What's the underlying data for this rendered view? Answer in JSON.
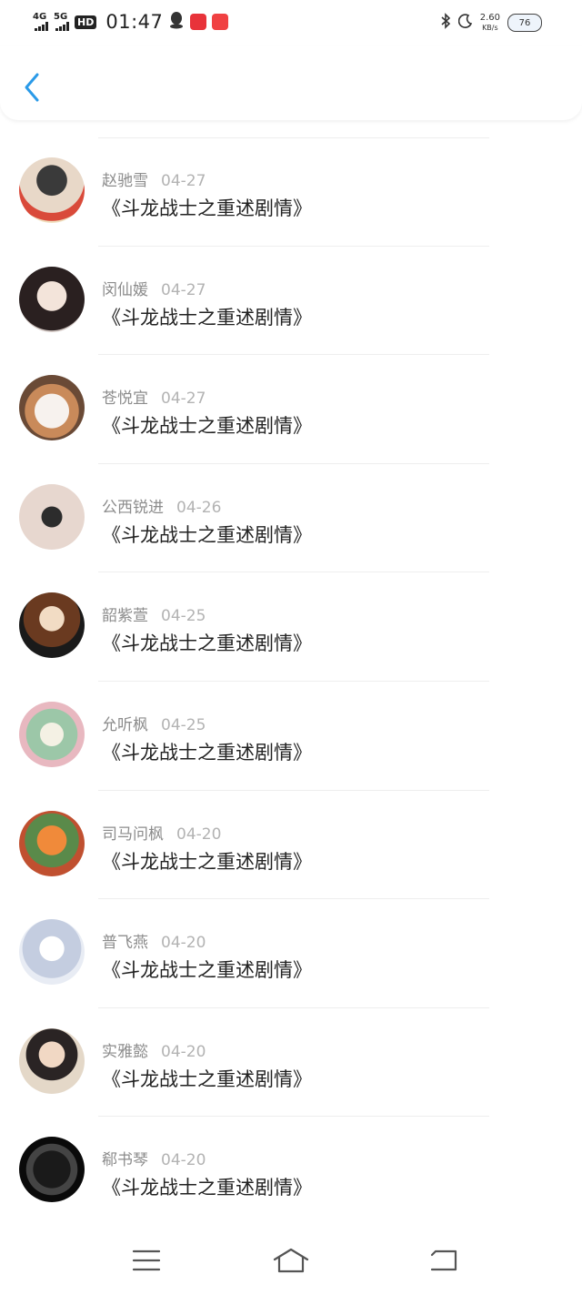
{
  "status_bar": {
    "net1": "4G",
    "net2": "5G",
    "hd": "HD",
    "time": "01:47",
    "speed_value": "2.60",
    "speed_unit": "KB/s",
    "battery": "76",
    "app_icons": [
      "qq-icon",
      "app-red-icon",
      "toutiao-icon"
    ]
  },
  "header": {
    "back_icon": "chevron-left-icon",
    "accent": "#2a9ae8"
  },
  "list": {
    "items": [
      {
        "name": "赵驰雪",
        "date": "04-27",
        "title": "《斗龙战士之重述剧情》"
      },
      {
        "name": "闵仙媛",
        "date": "04-27",
        "title": "《斗龙战士之重述剧情》"
      },
      {
        "name": "苍悦宜",
        "date": "04-27",
        "title": "《斗龙战士之重述剧情》"
      },
      {
        "name": "公西锐进",
        "date": "04-26",
        "title": "《斗龙战士之重述剧情》"
      },
      {
        "name": "韶紫萱",
        "date": "04-25",
        "title": "《斗龙战士之重述剧情》"
      },
      {
        "name": "允听枫",
        "date": "04-25",
        "title": "《斗龙战士之重述剧情》"
      },
      {
        "name": "司马问枫",
        "date": "04-20",
        "title": "《斗龙战士之重述剧情》"
      },
      {
        "name": "普飞燕",
        "date": "04-20",
        "title": "《斗龙战士之重述剧情》"
      },
      {
        "name": "实雅懿",
        "date": "04-20",
        "title": "《斗龙战士之重述剧情》"
      },
      {
        "name": "郗书琴",
        "date": "04-20",
        "title": "《斗龙战士之重述剧情》"
      }
    ]
  },
  "nav": {
    "menu_icon": "menu-icon",
    "home_icon": "home-icon",
    "back_icon": "back-icon"
  }
}
